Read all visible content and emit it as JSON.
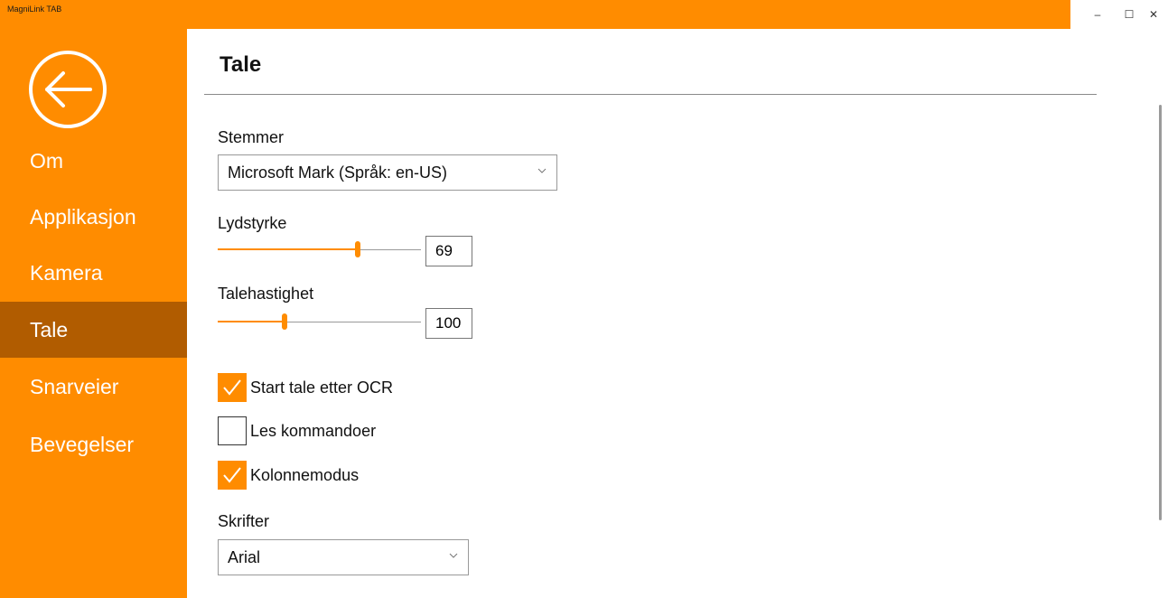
{
  "window": {
    "title": "MagniLink TAB",
    "minimize": "–",
    "maximize": "☐",
    "close": "✕"
  },
  "colors": {
    "accent": "#ff8c00",
    "active_nav": "#b15c00"
  },
  "sidebar": {
    "back_icon": "back-arrow-circle-icon",
    "items": [
      {
        "label": "Om",
        "active": false
      },
      {
        "label": "Applikasjon",
        "active": false
      },
      {
        "label": "Kamera",
        "active": false
      },
      {
        "label": "Tale",
        "active": true
      },
      {
        "label": "Snarveier",
        "active": false
      },
      {
        "label": "Bevegelser",
        "active": false
      }
    ]
  },
  "page": {
    "title": "Tale",
    "voices": {
      "label": "Stemmer",
      "value": "Microsoft Mark (Språk: en-US)"
    },
    "volume": {
      "label": "Lydstyrke",
      "value": "69",
      "fraction": 0.69
    },
    "speed": {
      "label": "Talehastighet",
      "value": "100",
      "fraction": 0.33
    },
    "checkboxes": [
      {
        "label": "Start tale etter OCR",
        "checked": true
      },
      {
        "label": "Les kommandoer",
        "checked": false
      },
      {
        "label": "Kolonnemodus",
        "checked": true
      }
    ],
    "fonts": {
      "label": "Skrifter",
      "value": "Arial"
    }
  }
}
